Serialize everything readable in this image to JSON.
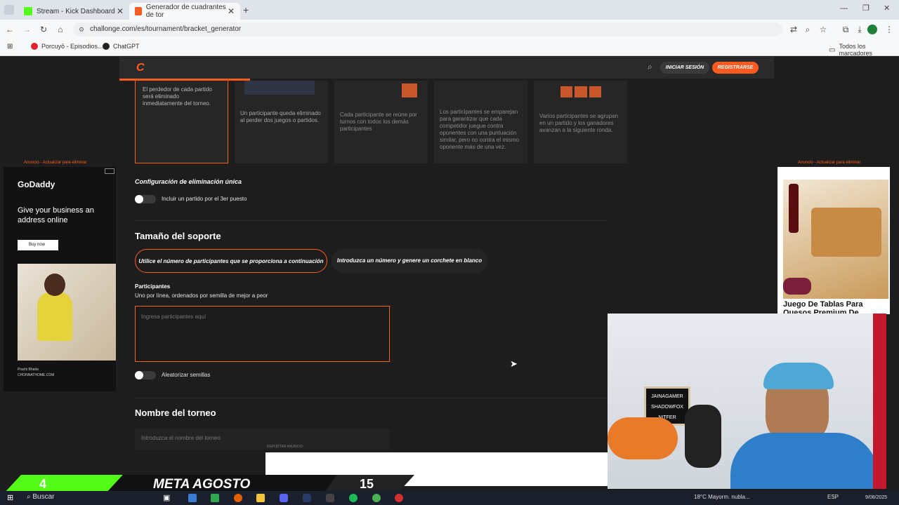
{
  "browser": {
    "tabs": [
      {
        "title": "Stream - Kick Dashboard",
        "fav_color": "#53fc18"
      },
      {
        "title": "Generador de cuadrantes de tor",
        "fav_color": "#ff5a1f"
      }
    ],
    "new_tab": "+",
    "url": "challonge.com/es/tournament/bracket_generator",
    "bookmarks": [
      {
        "label": "Porcuyō - Episodios...",
        "color": "#e0242e"
      },
      {
        "label": "ChatGPT",
        "color": "#222222"
      }
    ],
    "all_bookmarks": "Todos los marcadores"
  },
  "site": {
    "logo": "C",
    "login": "INICIAR SESIÓN",
    "register": "REGISTRARSE",
    "formats": [
      {
        "desc": "El perdedor de cada partido será eliminado inmediatamente del torneo.",
        "selected": true
      },
      {
        "desc": "Un participante queda eliminado al perder dos juegos o partidos."
      },
      {
        "desc": "Cada participante se reúne por turnos con todos los demás participantes"
      },
      {
        "desc": "Los participantes se emparejan para garantizar que cada competidor juegue contra oponentes con una puntuación similar, pero no contra el mismo oponente más de una vez."
      },
      {
        "desc": "Varios participantes se agrupan en un partido y los ganadores avanzan a la siguiente ronda."
      }
    ],
    "single_elim_config": "Configuración de eliminación única",
    "third_place": "Incluir un partido por el 3er puesto",
    "bracket_size": "Tamaño del soporte",
    "use_participants": "Utilice el número de participantes que se proporciona a continuación",
    "enter_number": "Introduzca un número y genere un corchete en blanco",
    "participants_label": "Participantes",
    "participants_help": "Uno por línea, ordenados por semilla de mejor a peor",
    "participants_placeholder": "Ingresa participantes aquí",
    "randomize": "Aleatorizar semillas",
    "tournament_name": "Nombre del torneo",
    "tournament_name_placeholder": "Introduzca el nombre del torneo",
    "report_ad": "REPORTAR ANUNCIO"
  },
  "ads": {
    "label": "Anuncio - Actualizar para eliminar",
    "left": {
      "brand": "GoDaddy",
      "headline": "Give your business an address online",
      "cta": "Buy now",
      "credit_name": "Prachi Bhatia",
      "credit_site": "CHONNATHOME.COM"
    },
    "right": {
      "title": "Juego De Tablas Para Quesos Premium De"
    }
  },
  "stream": {
    "left_count": "4",
    "goal": "META AGOSTO",
    "right_count": "15",
    "sign_lines": [
      "JAINAGAMER",
      "SHADOWFOX",
      "NITFER"
    ]
  },
  "taskbar": {
    "search": "Buscar",
    "weather": "18°C Mayorm. nubla...",
    "lang": "ESP",
    "date": "9/08/2025"
  }
}
